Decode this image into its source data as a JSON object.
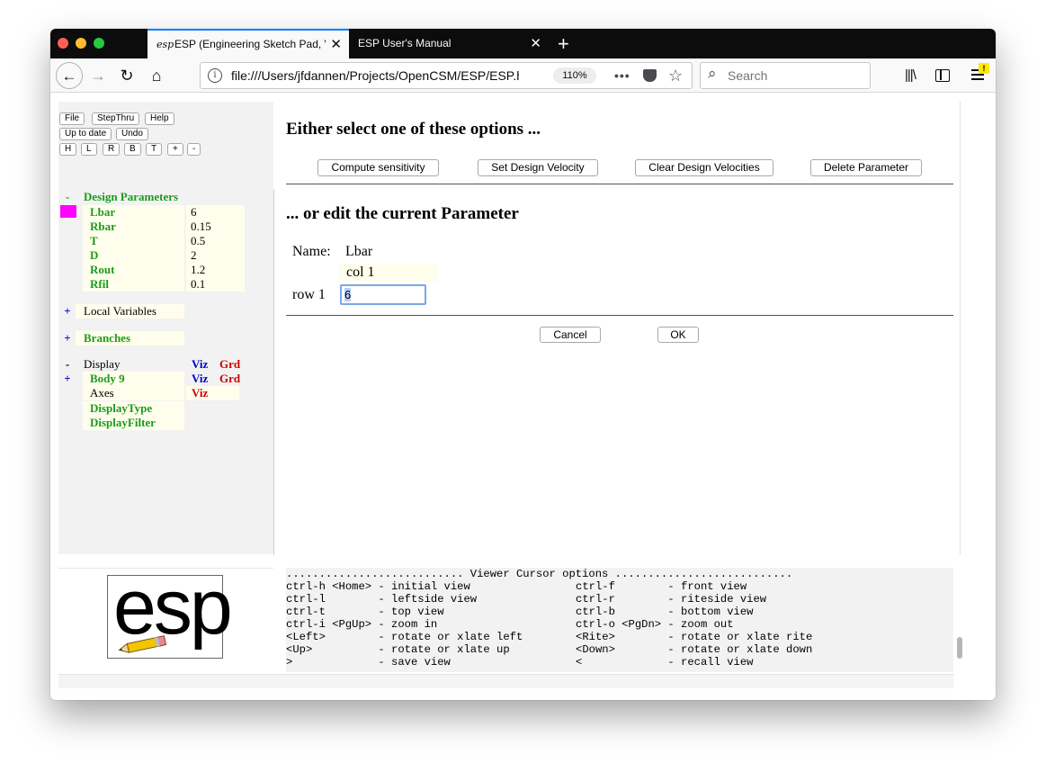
{
  "browser": {
    "tabs": [
      {
        "label": "ESP (Engineering Sketch Pad, V",
        "favicon": "esp",
        "active": true
      },
      {
        "label": "ESP User's Manual",
        "active": false
      }
    ],
    "new_tab_icon": "+",
    "url": "file:///Users/jfdannen/Projects/OpenCSM/ESP/ESP.h",
    "zoom": "110%",
    "search_placeholder": "Search",
    "menu_badge": "!"
  },
  "toolbar": {
    "file": "File",
    "stepthru": "StepThru",
    "help": "Help",
    "up_to_date": "Up to date",
    "undo": "Undo",
    "view_buttons": [
      "H",
      "L",
      "R",
      "B",
      "T",
      "+",
      "-"
    ]
  },
  "tree": {
    "design_parameters": {
      "toggle": "-",
      "label": "Design Parameters",
      "params": [
        {
          "name": "Lbar",
          "value": "6"
        },
        {
          "name": "Rbar",
          "value": "0.15"
        },
        {
          "name": "T",
          "value": "0.5"
        },
        {
          "name": "D",
          "value": "2"
        },
        {
          "name": "Rout",
          "value": "1.2"
        },
        {
          "name": "Rfil",
          "value": "0.1"
        }
      ]
    },
    "local_variables": {
      "toggle": "+",
      "label": "Local Variables"
    },
    "branches": {
      "toggle": "+",
      "label": "Branches"
    },
    "display": {
      "toggle": "-",
      "label": "Display",
      "viz": "Viz",
      "grd": "Grd",
      "body": {
        "toggle": "+",
        "label": "Body 9",
        "viz": "Viz",
        "grd": "Grd"
      },
      "axes": {
        "label": "Axes",
        "viz": "Viz"
      },
      "display_type": "DisplayType",
      "display_filter": "DisplayFilter"
    }
  },
  "main": {
    "heading1": "Either select one of these options ...",
    "buttons": {
      "compute_sensitivity": "Compute sensitivity",
      "set_design_velocity": "Set Design Velocity",
      "clear_design_velocities": "Clear Design Velocities",
      "delete_parameter": "Delete Parameter"
    },
    "heading2": "... or edit the current Parameter",
    "name_label": "Name:",
    "name_value": "Lbar",
    "col_header": "col 1",
    "row_header": "row 1",
    "cell_value": "6",
    "cancel": "Cancel",
    "ok": "OK"
  },
  "logo": {
    "text": "esp"
  },
  "console": {
    "title": "........................... Viewer Cursor options ...........................",
    "rows": [
      {
        "left": "ctrl-h <Home> - initial view",
        "right": "ctrl-f        - front view"
      },
      {
        "left": "ctrl-l        - leftside view",
        "right": "ctrl-r        - riteside view"
      },
      {
        "left": "ctrl-t        - top view",
        "right": "ctrl-b        - bottom view"
      },
      {
        "left": "ctrl-i <PgUp> - zoom in",
        "right": "ctrl-o <PgDn> - zoom out"
      },
      {
        "left": "<Left>        - rotate or xlate left",
        "right": "<Rite>        - rotate or xlate rite"
      },
      {
        "left": "<Up>          - rotate or xlate up",
        "right": "<Down>        - rotate or xlate down"
      },
      {
        "left": ">             - save view",
        "right": "<             - recall view"
      }
    ]
  },
  "colors": {
    "green_label": "#1a9c1a",
    "viz_blue": "#0000cc",
    "grd_red": "#cc0000",
    "selected_marker": "#ff00ff",
    "cell_bg": "#fffeec"
  }
}
